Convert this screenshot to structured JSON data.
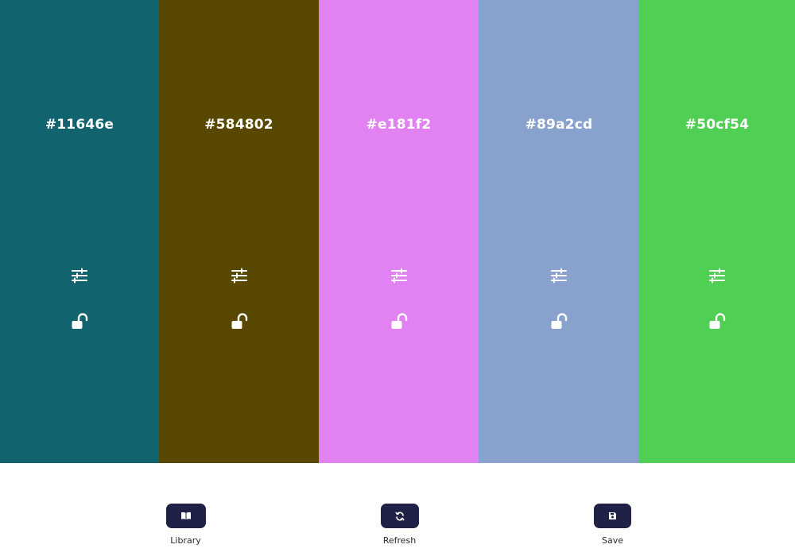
{
  "swatches": [
    {
      "hex": "#11646e",
      "color": "#11646e"
    },
    {
      "hex": "#584802",
      "color": "#584802"
    },
    {
      "hex": "#e181f2",
      "color": "#e181f2"
    },
    {
      "hex": "#89a2cd",
      "color": "#89a2cd"
    },
    {
      "hex": "#50cf54",
      "color": "#50cf54"
    }
  ],
  "toolbar": {
    "library_label": "Library",
    "refresh_label": "Refresh",
    "save_label": "Save",
    "button_color": "#1f2147"
  },
  "icons": {
    "adjust": "sliders-icon",
    "lock": "unlock-icon",
    "library": "book-open-icon",
    "refresh": "refresh-icon",
    "save": "floppy-disk-icon"
  }
}
